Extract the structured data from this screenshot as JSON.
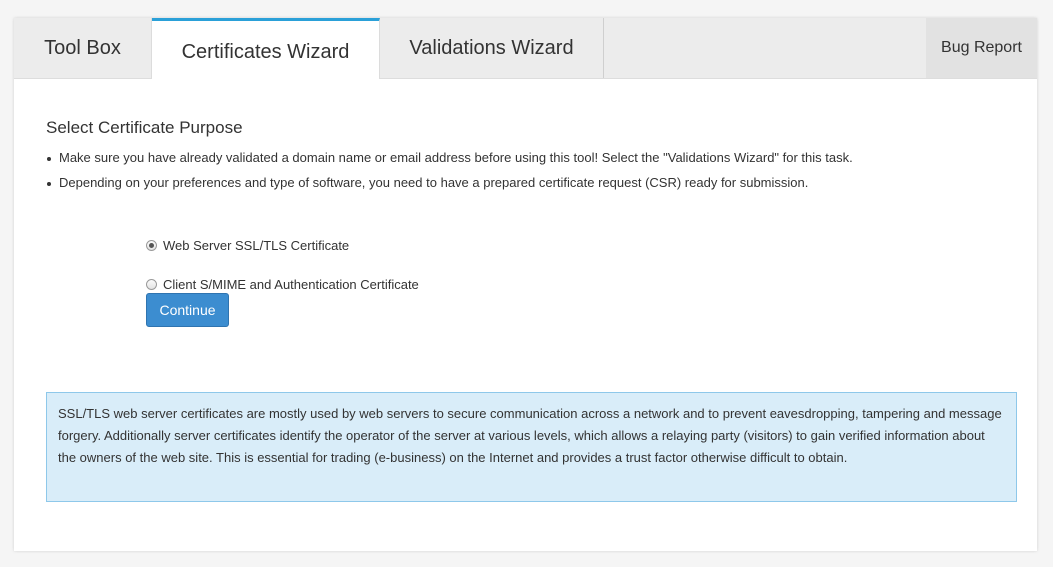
{
  "tabs": {
    "toolbox": "Tool Box",
    "certificates": "Certificates Wizard",
    "validations": "Validations Wizard",
    "bug_report": "Bug Report"
  },
  "main": {
    "heading": "Select Certificate Purpose",
    "bullets": [
      "Make sure you have already validated a domain name or email address before using this tool! Select the \"Validations Wizard\" for this task.",
      "Depending on your preferences and type of software, you need to have a prepared certificate request (CSR) ready for submission."
    ],
    "options": [
      {
        "label": "Web Server SSL/TLS Certificate",
        "checked": true
      },
      {
        "label": "Client S/MIME and Authentication Certificate",
        "checked": false
      }
    ],
    "continue_label": "Continue"
  },
  "info": {
    "text": "SSL/TLS web server certificates are mostly used by web servers to secure communication across a network and to prevent eavesdropping, tampering and message forgery. Additionally server certificates identify the operator of the server at various levels, which allows a relaying party (visitors) to gain verified information about the owners of the web site. This is essential for trading (e-business) on the Internet and provides a trust factor otherwise difficult to obtain."
  },
  "colors": {
    "accent": "#2aa0d8",
    "button": "#3c8dd0",
    "info_bg": "#d9edf9",
    "info_border": "#8ec8ea"
  }
}
